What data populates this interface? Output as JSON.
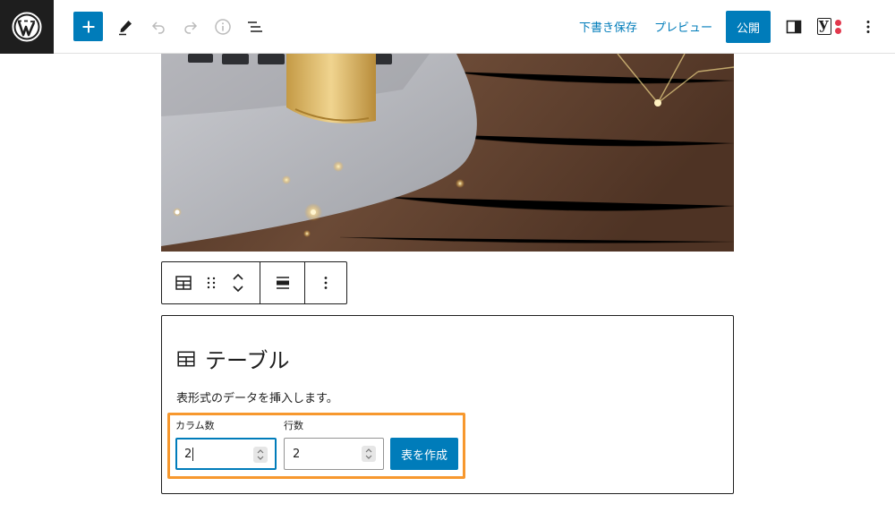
{
  "topbar": {
    "save_draft": "下書き保存",
    "preview": "プレビュー",
    "publish": "公開",
    "yoast_letter": "y"
  },
  "table_block": {
    "title": "テーブル",
    "instructions": "表形式のデータを挿入します。",
    "columns_label": "カラム数",
    "columns_value": "2",
    "rows_label": "行数",
    "rows_value": "2",
    "create_button": "表を作成"
  },
  "colors": {
    "accent": "#007cba",
    "highlight": "#f7982e",
    "dark": "#1e1e1e",
    "yoast_dot": "#e2384d"
  },
  "icons": [
    "wordpress-logo-icon",
    "plus-icon",
    "pencil-icon",
    "undo-icon",
    "redo-icon",
    "info-icon",
    "list-view-icon",
    "sidebar-toggle-icon",
    "yoast-icon",
    "more-vertical-icon",
    "table-icon",
    "drag-handle-icon",
    "chevron-up-icon",
    "chevron-down-icon",
    "align-icon"
  ]
}
